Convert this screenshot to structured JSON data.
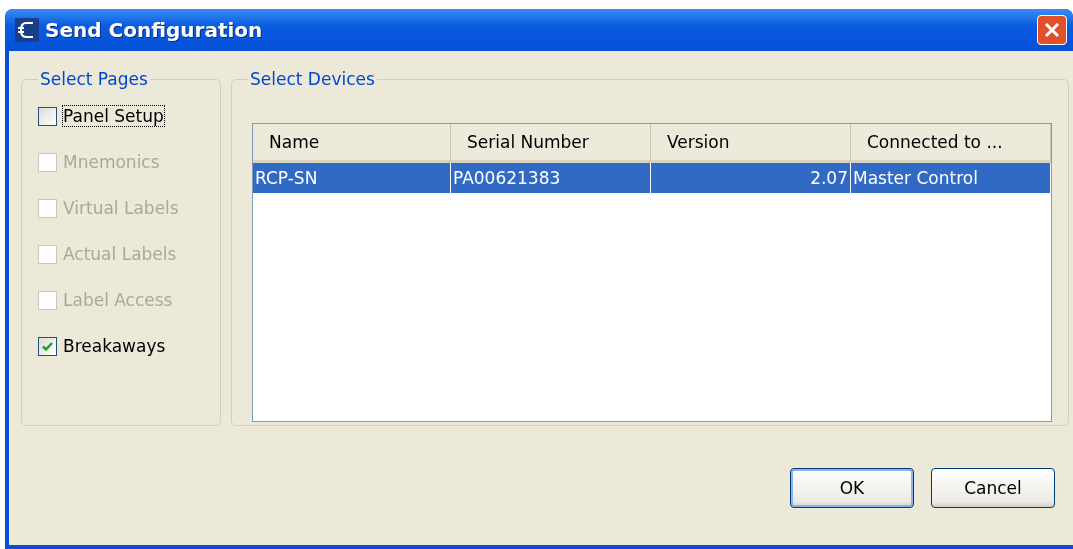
{
  "window": {
    "title": "Send Configuration"
  },
  "pages": {
    "legend": "Select Pages",
    "items": [
      {
        "label": "Panel Setup",
        "checked": false,
        "disabled": false,
        "focused": true
      },
      {
        "label": "Mnemonics",
        "checked": false,
        "disabled": true,
        "focused": false
      },
      {
        "label": "Virtual Labels",
        "checked": false,
        "disabled": true,
        "focused": false
      },
      {
        "label": "Actual Labels",
        "checked": false,
        "disabled": true,
        "focused": false
      },
      {
        "label": "Label Access",
        "checked": false,
        "disabled": true,
        "focused": false
      },
      {
        "label": "Breakaways",
        "checked": true,
        "disabled": false,
        "focused": false
      }
    ]
  },
  "devices": {
    "legend": "Select Devices",
    "columns": [
      "Name",
      "Serial Number",
      "Version",
      "Connected to ..."
    ],
    "rows": [
      {
        "cells": [
          "RCP-SN",
          "PA00621383",
          "2.07",
          "Master Control"
        ],
        "selected": true
      }
    ]
  },
  "buttons": [
    {
      "label": "OK",
      "default": true
    },
    {
      "label": "Cancel",
      "default": false
    }
  ]
}
